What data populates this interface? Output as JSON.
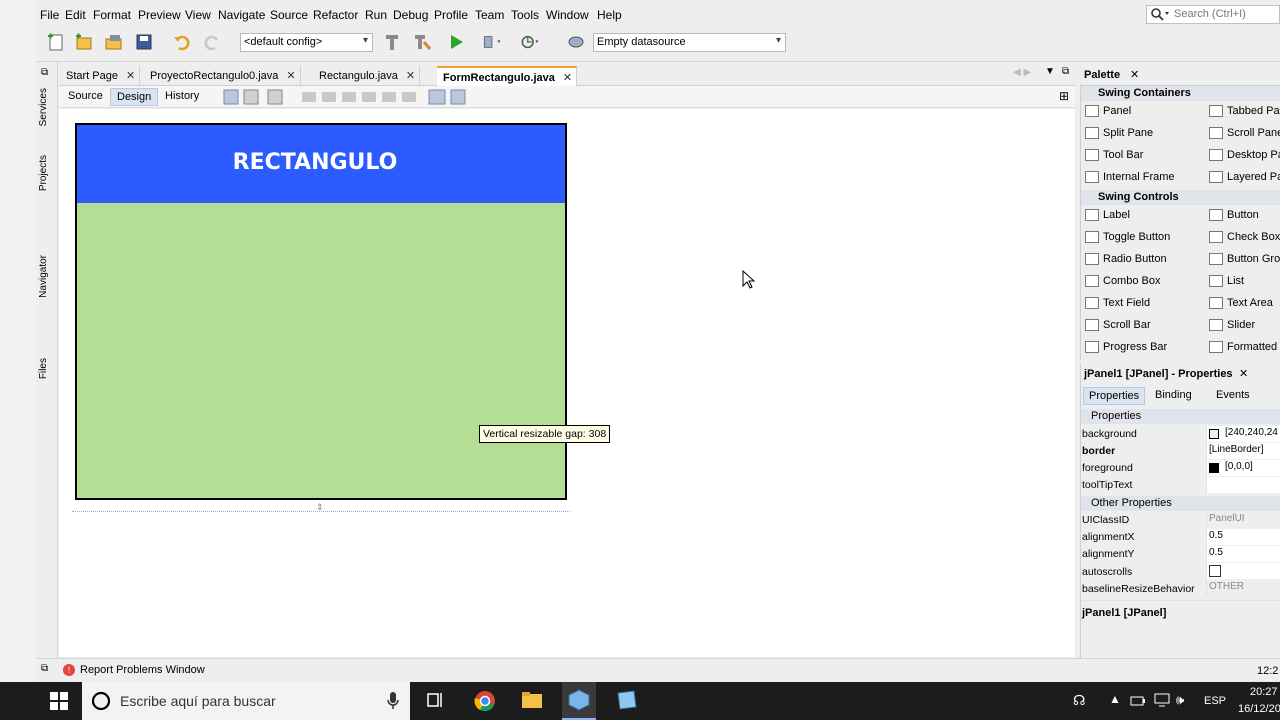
{
  "menubar": {
    "items": [
      "File",
      "Edit",
      "Format",
      "Preview",
      "View",
      "Navigate",
      "Source",
      "Refactor",
      "Run",
      "Debug",
      "Profile",
      "Team",
      "Tools",
      "Window",
      "Help"
    ],
    "search_placeholder": "Search (Ctrl+I)"
  },
  "toolbar": {
    "config": "<default config>",
    "datasource": "Empty datasource"
  },
  "side_panels": [
    "Services",
    "Projects",
    "Navigator",
    "Files"
  ],
  "editor": {
    "tabs": [
      "Start Page",
      "ProyectoRectangulo0.java",
      "Rectangulo.java",
      "FormRectangulo.java"
    ],
    "active_tab": "FormRectangulo.java",
    "views": [
      "Source",
      "Design",
      "History"
    ],
    "active_view": "Design"
  },
  "form": {
    "title": "RECTANGULO",
    "header_color": "#2c5cff",
    "body_color": "#b4de96",
    "tooltip": "Vertical resizable gap: 308"
  },
  "palette": {
    "title": "Palette",
    "containers_title": "Swing Containers",
    "containers": [
      "Panel",
      "Tabbed Pan",
      "Split Pane",
      "Scroll Pane",
      "Tool Bar",
      "Desktop Pa",
      "Internal Frame",
      "Layered Pa"
    ],
    "controls_title": "Swing Controls",
    "controls": [
      "Label",
      "Button",
      "Toggle Button",
      "Check Box",
      "Radio Button",
      "Button Grou",
      "Combo Box",
      "List",
      "Text Field",
      "Text Area",
      "Scroll Bar",
      "Slider",
      "Progress Bar",
      "Formatted F"
    ]
  },
  "properties": {
    "title": "jPanel1 [JPanel] - Properties",
    "tabs": [
      "Properties",
      "Binding",
      "Events"
    ],
    "section1": "Properties",
    "rows1": [
      {
        "name": "background",
        "value": "[240,240,24"
      },
      {
        "name": "border",
        "value": "[LineBorder]"
      },
      {
        "name": "foreground",
        "value": "[0,0,0]"
      },
      {
        "name": "toolTipText",
        "value": ""
      }
    ],
    "section2": "Other Properties",
    "rows2": [
      {
        "name": "UIClassID",
        "value": "PanelUI"
      },
      {
        "name": "alignmentX",
        "value": "0.5"
      },
      {
        "name": "alignmentY",
        "value": "0.5"
      },
      {
        "name": "autoscrolls",
        "value": ""
      },
      {
        "name": "baselineResizeBehavior",
        "value": "OTHER"
      }
    ],
    "footer": "jPanel1 [JPanel]"
  },
  "status": {
    "report": "Report Problems Window",
    "right": "12:2"
  },
  "taskbar": {
    "search_placeholder": "Escribe aquí para buscar",
    "lang": "ESP",
    "time": "20:27",
    "date": "16/12/20"
  }
}
